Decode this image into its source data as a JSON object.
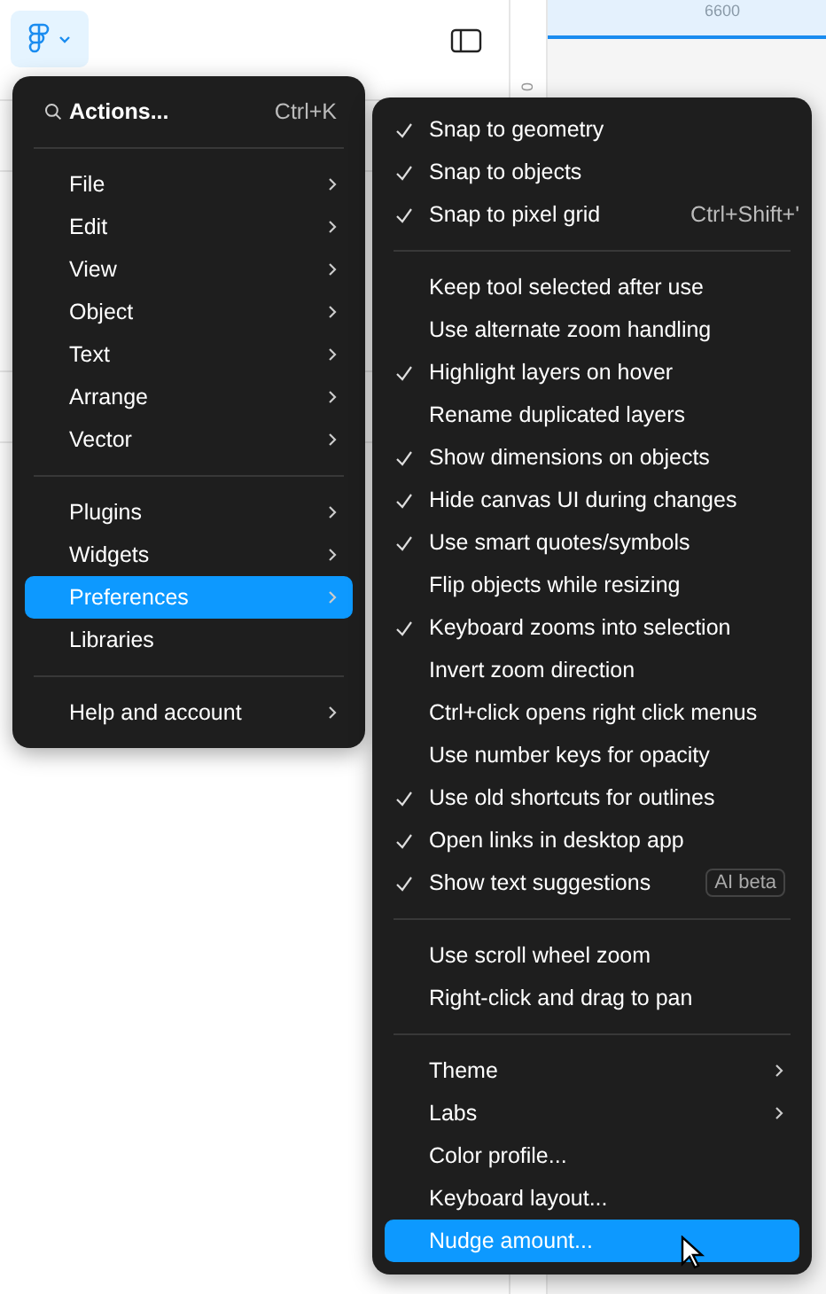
{
  "ruler": {
    "top_label": "6600",
    "side_label": "0"
  },
  "main_menu": {
    "search": {
      "label": "Actions...",
      "shortcut": "Ctrl+K"
    },
    "sections": [
      [
        {
          "label": "File",
          "submenu": true,
          "selected": false
        },
        {
          "label": "Edit",
          "submenu": true,
          "selected": false
        },
        {
          "label": "View",
          "submenu": true,
          "selected": false
        },
        {
          "label": "Object",
          "submenu": true,
          "selected": false
        },
        {
          "label": "Text",
          "submenu": true,
          "selected": false
        },
        {
          "label": "Arrange",
          "submenu": true,
          "selected": false
        },
        {
          "label": "Vector",
          "submenu": true,
          "selected": false
        }
      ],
      [
        {
          "label": "Plugins",
          "submenu": true,
          "selected": false
        },
        {
          "label": "Widgets",
          "submenu": true,
          "selected": false
        },
        {
          "label": "Preferences",
          "submenu": true,
          "selected": true
        },
        {
          "label": "Libraries",
          "submenu": false,
          "selected": false
        }
      ],
      [
        {
          "label": "Help and account",
          "submenu": true,
          "selected": false
        }
      ]
    ]
  },
  "preferences_menu": {
    "sections": [
      [
        {
          "label": "Snap to geometry",
          "checked": true,
          "selected": false
        },
        {
          "label": "Snap to objects",
          "checked": true,
          "selected": false
        },
        {
          "label": "Snap to pixel grid",
          "checked": true,
          "shortcut": "Ctrl+Shift+'",
          "selected": false
        }
      ],
      [
        {
          "label": "Keep tool selected after use",
          "checked": false,
          "selected": false
        },
        {
          "label": "Use alternate zoom handling",
          "checked": false,
          "selected": false
        },
        {
          "label": "Highlight layers on hover",
          "checked": true,
          "selected": false
        },
        {
          "label": "Rename duplicated layers",
          "checked": false,
          "selected": false
        },
        {
          "label": "Show dimensions on objects",
          "checked": true,
          "selected": false
        },
        {
          "label": "Hide canvas UI during changes",
          "checked": true,
          "selected": false
        },
        {
          "label": "Use smart quotes/symbols",
          "checked": true,
          "selected": false
        },
        {
          "label": "Flip objects while resizing",
          "checked": false,
          "selected": false
        },
        {
          "label": "Keyboard zooms into selection",
          "checked": true,
          "selected": false
        },
        {
          "label": "Invert zoom direction",
          "checked": false,
          "selected": false
        },
        {
          "label": "Ctrl+click opens right click menus",
          "checked": false,
          "selected": false
        },
        {
          "label": "Use number keys for opacity",
          "checked": false,
          "selected": false
        },
        {
          "label": "Use old shortcuts for outlines",
          "checked": true,
          "selected": false
        },
        {
          "label": "Open links in desktop app",
          "checked": true,
          "selected": false
        },
        {
          "label": "Show text suggestions",
          "checked": true,
          "badge": "AI beta",
          "selected": false
        }
      ],
      [
        {
          "label": "Use scroll wheel zoom",
          "checked": false,
          "selected": false
        },
        {
          "label": "Right-click and drag to pan",
          "checked": false,
          "selected": false
        }
      ],
      [
        {
          "label": "Theme",
          "checked": false,
          "submenu": true,
          "selected": false
        },
        {
          "label": "Labs",
          "checked": false,
          "submenu": true,
          "selected": false
        },
        {
          "label": "Color profile...",
          "checked": false,
          "selected": false
        },
        {
          "label": "Keyboard layout...",
          "checked": false,
          "selected": false
        },
        {
          "label": "Nudge amount...",
          "checked": false,
          "selected": true
        }
      ]
    ]
  }
}
